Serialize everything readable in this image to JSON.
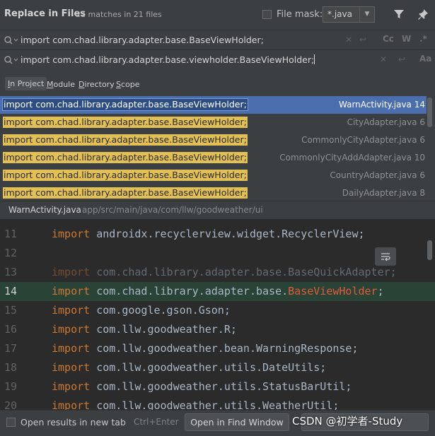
{
  "header": {
    "title": "Replace in Files",
    "matches": "21 matches in 21 files",
    "file_mask_label": "File mask:",
    "file_mask_value": "*.java"
  },
  "search": {
    "find_text": "import com.chad.library.adapter.base.BaseViewHolder;",
    "replace_text": "import com.chad.library.adapter.base.viewholder.BaseViewHolder;",
    "find_options": [
      "Cc",
      "W",
      ".*"
    ]
  },
  "scopes": [
    {
      "label": "In Project",
      "active": true
    },
    {
      "label": "Module",
      "active": false
    },
    {
      "label": "Directory",
      "active": false
    },
    {
      "label": "Scope",
      "active": false
    }
  ],
  "results": [
    {
      "match": "import com.chad.library.adapter.base.BaseViewHolder;",
      "file": "WarnActivity.java 14",
      "selected": true
    },
    {
      "match": "import com.chad.library.adapter.base.BaseViewHolder;",
      "file": "CityAdapter.java 6",
      "selected": false
    },
    {
      "match": "import com.chad.library.adapter.base.BaseViewHolder;",
      "file": "CommonlyCityAdapter.java 6",
      "selected": false
    },
    {
      "match": "import com.chad.library.adapter.base.BaseViewHolder;",
      "file": "CommonlyCityAddAdapter.java 10",
      "selected": false
    },
    {
      "match": "import com.chad.library.adapter.base.BaseViewHolder;",
      "file": "CountryAdapter.java 6",
      "selected": false
    },
    {
      "match": "import com.chad.library.adapter.base.BaseViewHolder;",
      "file": "DailyAdapter.java 8",
      "selected": false
    }
  ],
  "path": {
    "file": "WarnActivity.java",
    "dir": "app/src/main/java/com/llw/goodweather/ui"
  },
  "editor": {
    "lines": [
      {
        "num": "11",
        "kw": "import",
        "rest": " androidx.recyclerview.widget.RecyclerView;",
        "match": "",
        "tail": "",
        "dim": false
      },
      {
        "num": "12",
        "kw": "",
        "rest": "",
        "match": "",
        "tail": "",
        "dim": false
      },
      {
        "num": "13",
        "kw": "import",
        "rest": " com.chad.library.adapter.base.BaseQuickAdapter;",
        "match": "",
        "tail": "",
        "dim": true
      },
      {
        "num": "14",
        "kw": "import",
        "rest": " com.chad.library.adapter.base.",
        "match": "BaseViewHolder",
        "tail": ";",
        "dim": false,
        "current": true
      },
      {
        "num": "15",
        "kw": "import",
        "rest": " com.google.gson.Gson;",
        "match": "",
        "tail": "",
        "dim": false
      },
      {
        "num": "16",
        "kw": "import",
        "rest": " com.llw.goodweather.R;",
        "match": "",
        "tail": "",
        "dim": false
      },
      {
        "num": "17",
        "kw": "import",
        "rest": " com.llw.goodweather.bean.WarningResponse;",
        "match": "",
        "tail": "",
        "dim": false
      },
      {
        "num": "18",
        "kw": "import",
        "rest": " com.llw.goodweather.utils.DateUtils;",
        "match": "",
        "tail": "",
        "dim": false
      },
      {
        "num": "19",
        "kw": "import",
        "rest": " com.llw.goodweather.utils.StatusBarUtil;",
        "match": "",
        "tail": "",
        "dim": false
      },
      {
        "num": "20",
        "kw": "import",
        "rest": " com.llw.goodweather.utils.WeatherUtil;",
        "match": "",
        "tail": "",
        "dim": false
      }
    ]
  },
  "footer": {
    "open_new_tab_label": "Open results in new tab",
    "shortcut": "Ctrl+Enter",
    "open_find_window_label": "Open in Find Window",
    "watermark": "CSDN @初学者-Study"
  },
  "colors": {
    "accent": "#4b6eaf",
    "match_highlight": "#e2c056",
    "keyword": "#cc7832",
    "current_line": "#294436"
  }
}
